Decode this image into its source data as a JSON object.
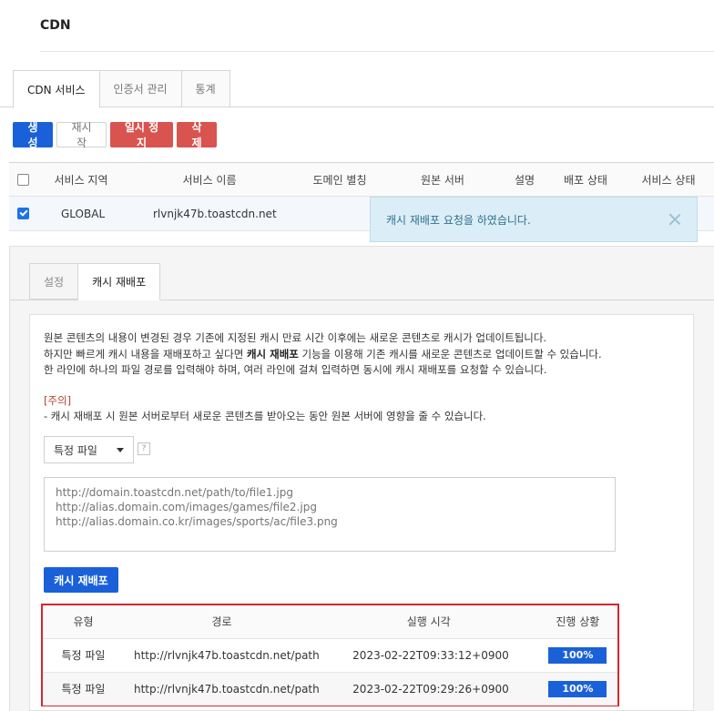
{
  "page": {
    "title": "CDN"
  },
  "main_tabs": [
    {
      "label": "CDN 서비스",
      "active": true
    },
    {
      "label": "인증서 관리",
      "active": false
    },
    {
      "label": "통계",
      "active": false
    }
  ],
  "toolbar": {
    "create_label": "생성",
    "restart_label": "재시작",
    "pause_label": "일시 정지",
    "delete_label": "삭제"
  },
  "service_grid": {
    "columns": [
      "서비스 지역",
      "서비스 이름",
      "도메인 별칭",
      "원본 서버",
      "설명",
      "배포 상태",
      "서비스 상태"
    ],
    "rows": [
      {
        "selected": true,
        "region": "GLOBAL",
        "name": "rlvnjk47b.toastcdn.net"
      }
    ]
  },
  "toast": {
    "message": "캐시 재배포 요청을 하였습니다."
  },
  "detail_tabs": [
    {
      "label": "설정",
      "active": false
    },
    {
      "label": "캐시 재배포",
      "active": true
    }
  ],
  "purge": {
    "desc_line1": "원본 콘텐츠의 내용이 변경된 경우 기존에 지정된 캐시 만료 시간 이후에는 새로운 콘텐츠로 캐시가 업데이트됩니다.",
    "desc_line2_pre": "하지만 빠르게 캐시 내용을 재배포하고 싶다면 ",
    "desc_line2_bold": "캐시 재배포",
    "desc_line2_post": " 기능을 이용해 기존 캐시를 새로운 콘텐츠로 업데이트할 수 있습니다.",
    "desc_line3": "한 라인에 하나의 파일 경로를 입력해야 하며, 여러 라인에 걸쳐 입력하면 동시에 캐시 재배포를 요청할 수 있습니다.",
    "caution_title": "[주의]",
    "caution_text": "- 캐시 재배포 시 원본 서버로부터 새로운 콘텐츠를 받아오는 동안 원본 서버에 영향을 줄 수 있습니다.",
    "type_select_value": "특정 파일",
    "help_label": "?",
    "textarea_placeholder": "http://domain.toastcdn.net/path/to/file1.jpg\nhttp://alias.domain.com/images/games/file2.jpg\nhttp://alias.domain.co.kr/images/sports/ac/file3.png",
    "submit_label": "캐시 재배포"
  },
  "history": {
    "columns": [
      "유형",
      "경로",
      "실행 시각",
      "진행 상황"
    ],
    "rows": [
      {
        "type": "특정 파일",
        "path": "http://rlvnjk47b.toastcdn.net/path",
        "time": "2023-02-22T09:33:12+0900",
        "progress": "100%"
      },
      {
        "type": "특정 파일",
        "path": "http://rlvnjk47b.toastcdn.net/path",
        "time": "2023-02-22T09:29:26+0900",
        "progress": "100%"
      }
    ]
  }
}
